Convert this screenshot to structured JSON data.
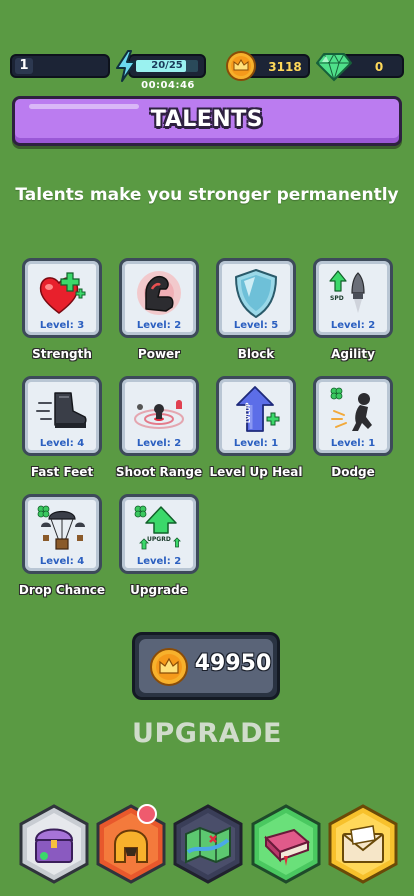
{
  "status_bar": {
    "player_level": "1",
    "energy": {
      "label": "20/25",
      "fraction": 0.8
    },
    "timer": "00:04:46",
    "coins": "3118",
    "gems": "0"
  },
  "header": {
    "title": "TALENTS"
  },
  "subtitle": "Talents make you stronger permanently",
  "talents": [
    {
      "name": "Strength",
      "level": "Level: 3",
      "icon": "heart-plus-icon"
    },
    {
      "name": "Power",
      "level": "Level: 2",
      "icon": "flexed-arm-icon"
    },
    {
      "name": "Block",
      "level": "Level: 5",
      "icon": "shield-icon"
    },
    {
      "name": "Agility",
      "level": "Level: 2",
      "icon": "rocket-speed-icon"
    },
    {
      "name": "Fast Feet",
      "level": "Level: 4",
      "icon": "boot-icon"
    },
    {
      "name": "Shoot Range",
      "level": "Level: 2",
      "icon": "target-icon"
    },
    {
      "name": "Level Up Heal",
      "level": "Level: 1",
      "icon": "levelup-arrow-icon"
    },
    {
      "name": "Dodge",
      "level": "Level: 1",
      "icon": "dodge-figure-icon"
    },
    {
      "name": "Drop Chance",
      "level": "Level: 4",
      "icon": "parachute-crate-icon"
    },
    {
      "name": "Upgrade",
      "level": "Level: 2",
      "icon": "upgrade-arrow-icon"
    }
  ],
  "talent_art_text": {
    "levelup": "LVLUP",
    "upgrade": "UPGRD",
    "agility_sign": "SPD"
  },
  "cost": {
    "value": "49950"
  },
  "upgrade_button": {
    "label": "UPGRADE"
  },
  "nav": [
    {
      "id": "shop",
      "icon": "treasure-chest-icon"
    },
    {
      "id": "equipment",
      "icon": "helmet-icon",
      "badge": true
    },
    {
      "id": "map",
      "icon": "map-icon"
    },
    {
      "id": "talents",
      "icon": "book-icon"
    },
    {
      "id": "mail",
      "icon": "mail-icon"
    }
  ],
  "colors": {
    "background": "#5a9a43",
    "header": "#bb7cf0",
    "level_text": "#2b5fc0",
    "coin": "#f7b12c",
    "gem": "#4fe08a",
    "badge": "#ef5b6e"
  }
}
